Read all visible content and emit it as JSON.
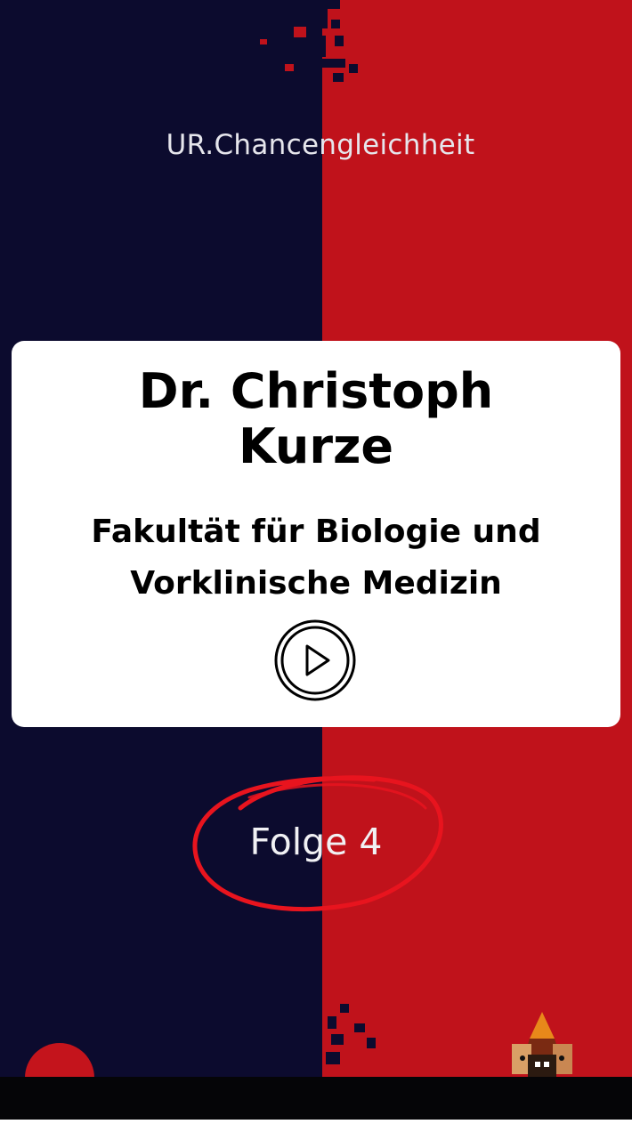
{
  "brand": {
    "label": "UR.Chancengleichheit"
  },
  "card": {
    "name_line1": "Dr. Christoph",
    "name_line2": "Kurze",
    "faculty_line1": "Fakultät für Biologie und",
    "faculty_line2": "Vorklinische Medizin",
    "play_icon": "play-circle-icon"
  },
  "episode": {
    "label": "Folge 4"
  },
  "colors": {
    "navy": "#0c0b2e",
    "red": "#c0121b",
    "card": "#ffffff",
    "text": "#000000"
  }
}
